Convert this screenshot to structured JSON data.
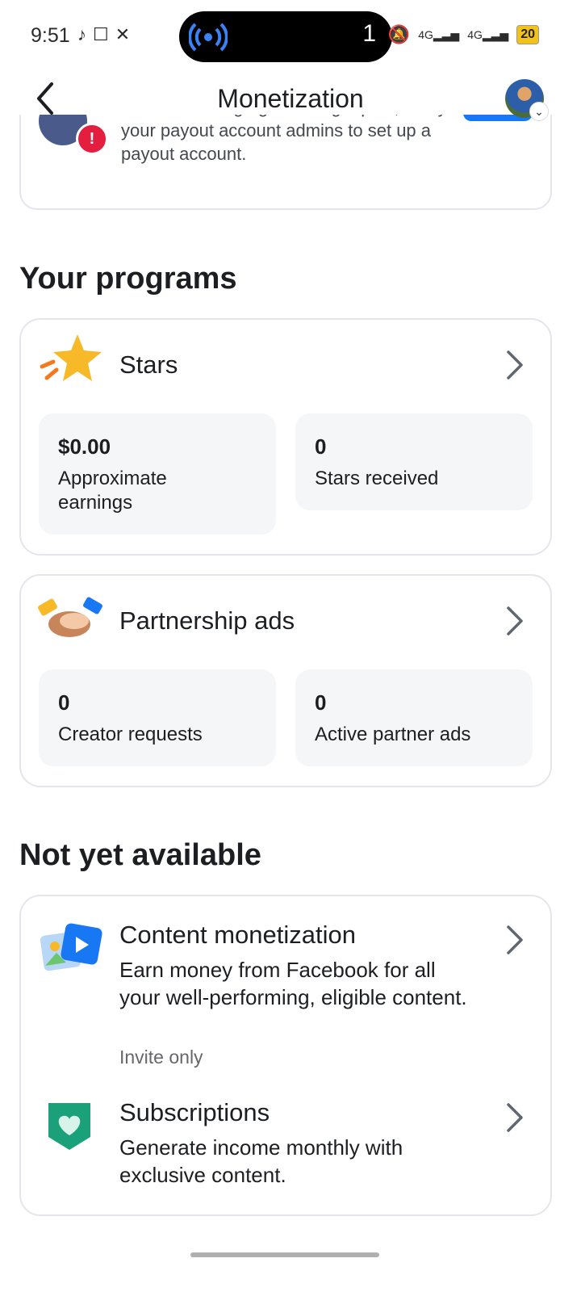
{
  "status_bar": {
    "time": "9:51",
    "left_icons": [
      "tiktok-icon",
      "square-icon",
      "x-icon"
    ],
    "pill_count": "1",
    "network": [
      "4G",
      "4G"
    ],
    "battery": "20"
  },
  "header": {
    "title": "Monetization"
  },
  "payout_notice": {
    "text": "To start earning again and get paid, notify your payout account admins to set up a payout account."
  },
  "your_programs": {
    "heading": "Your programs",
    "stars": {
      "title": "Stars",
      "stats": [
        {
          "value": "$0.00",
          "label": "Approximate earnings"
        },
        {
          "value": "0",
          "label": "Stars received"
        }
      ]
    },
    "partnership_ads": {
      "title": "Partnership ads",
      "stats": [
        {
          "value": "0",
          "label": "Creator requests"
        },
        {
          "value": "0",
          "label": "Active partner ads"
        }
      ]
    }
  },
  "not_yet_available": {
    "heading": "Not yet available",
    "items": [
      {
        "title": "Content monetization",
        "description": "Earn money from Facebook for all your well-performing, eligible content.",
        "note": "Invite only"
      },
      {
        "title": "Subscriptions",
        "description": "Generate income monthly with exclusive content."
      }
    ]
  },
  "colors": {
    "accent": "#1877f2",
    "card_border": "#e4e6eb",
    "stat_bg": "#f5f6f8",
    "warning": "#e41e3f"
  }
}
